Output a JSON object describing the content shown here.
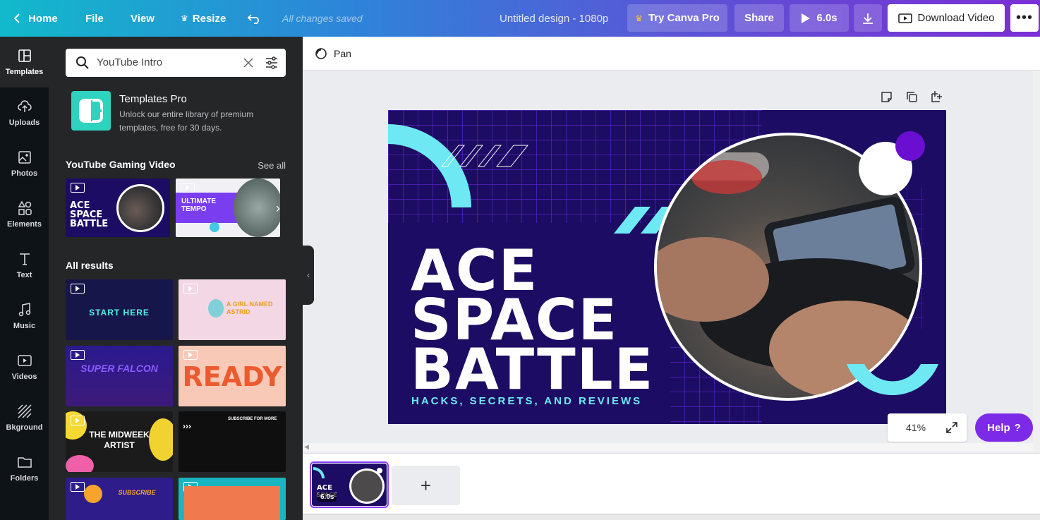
{
  "topbar": {
    "home": "Home",
    "file": "File",
    "view": "View",
    "resize": "Resize",
    "saved_status": "All changes saved",
    "design_title": "Untitled design - 1080p",
    "try_pro": "Try Canva Pro",
    "share": "Share",
    "play_duration": "6.0s",
    "download_video": "Download Video"
  },
  "rail": {
    "items": [
      {
        "label": "Templates",
        "icon": "templates-icon"
      },
      {
        "label": "Uploads",
        "icon": "upload-cloud-icon"
      },
      {
        "label": "Photos",
        "icon": "photo-icon"
      },
      {
        "label": "Elements",
        "icon": "shapes-icon"
      },
      {
        "label": "Text",
        "icon": "text-icon"
      },
      {
        "label": "Music",
        "icon": "music-note-icon"
      },
      {
        "label": "Videos",
        "icon": "video-icon"
      },
      {
        "label": "Bkground",
        "icon": "background-stripes-icon"
      },
      {
        "label": "Folders",
        "icon": "folder-icon"
      }
    ]
  },
  "panel": {
    "search_value": "YouTube Intro",
    "pro_title": "Templates Pro",
    "pro_desc": "Unlock our entire library of premium templates, free for 30 days.",
    "section1_title": "YouTube Gaming Video",
    "see_all": "See all",
    "featured": [
      {
        "text": "ACE SPACE BATTLE"
      },
      {
        "text": "ULTIMATE TEMPO"
      }
    ],
    "section2_title": "All results",
    "results": [
      {
        "text": "START HERE"
      },
      {
        "text": "A GIRL NAMED ASTRID"
      },
      {
        "text": "SUPER FALCON"
      },
      {
        "text": "READY"
      },
      {
        "text": "THE MIDWEEK ARTIST"
      },
      {
        "text": "SUBSCRIBE FOR MORE"
      },
      {
        "text": "SUBSCRIBE"
      },
      {
        "text": ""
      }
    ]
  },
  "canvas": {
    "pan_label": "Pan",
    "design": {
      "line1": "ACE",
      "line2": "SPACE",
      "line3": "BATTLE",
      "subtitle": "HACKS, SECRETS, AND REVIEWS"
    },
    "zoom": "41%",
    "help": "Help",
    "page_duration": "6.0s"
  },
  "colors": {
    "brand_purple": "#7d2ae8",
    "design_bg": "#1d0c63",
    "accent_cyan": "#6ee8f3",
    "grid_purple": "#5b2fd6"
  }
}
